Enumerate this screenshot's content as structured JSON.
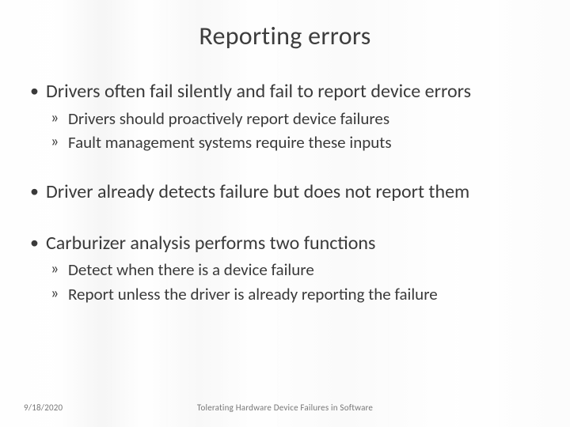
{
  "title": "Reporting errors",
  "bullets": [
    {
      "text": "Drivers often fail silently and fail to report device errors",
      "sub": [
        "Drivers should proactively report device failures",
        "Fault management systems require these inputs"
      ]
    },
    {
      "text": "Driver already detects failure but does not report them",
      "sub": []
    },
    {
      "text": "Carburizer analysis performs two functions",
      "sub": [
        "Detect when there is a device failure",
        "Report unless the driver is already reporting the failure"
      ]
    }
  ],
  "footer": {
    "date": "9/18/2020",
    "title": "Tolerating Hardware Device Failures in Software"
  }
}
